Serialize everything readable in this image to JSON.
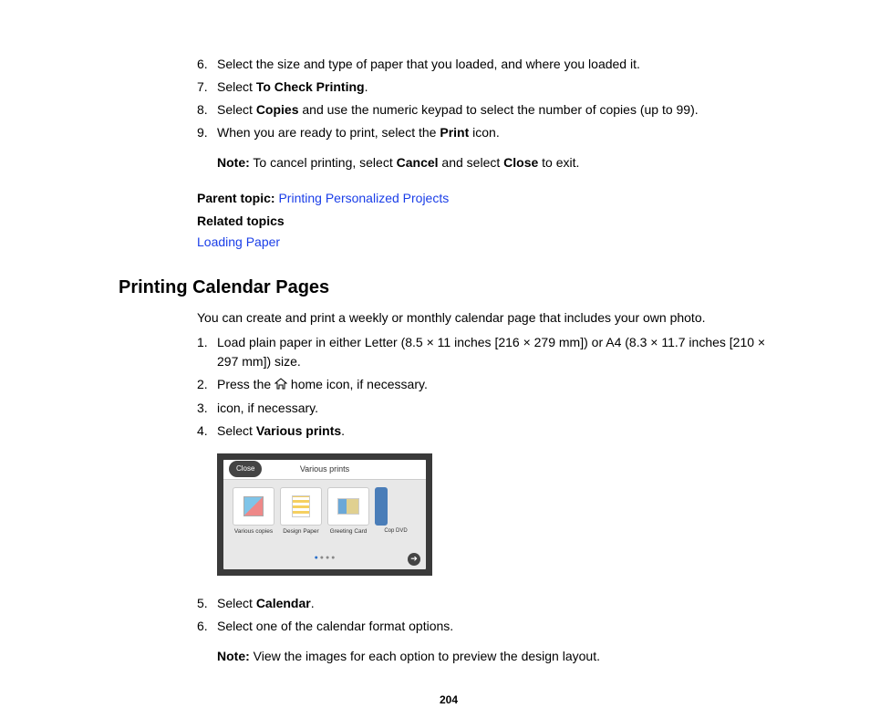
{
  "steps_top": [
    {
      "num": "6.",
      "text": "Select the size and type of paper that you loaded, and where you loaded it."
    },
    {
      "num": "7.",
      "prefix": "Select ",
      "bold": "To Check Printing",
      "suffix": "."
    },
    {
      "num": "8.",
      "prefix": "Select ",
      "bold": "Copies",
      "suffix": " and use the numeric keypad to select the number of copies (up to 99)."
    },
    {
      "num": "9.",
      "prefix": "When you are ready to print, select the ",
      "bold": "Print",
      "suffix": " icon."
    }
  ],
  "note1": {
    "label": "Note:",
    "prefix": " To cancel printing, select ",
    "bold1": "Cancel",
    "mid": " and select ",
    "bold2": "Close",
    "suffix": " to exit."
  },
  "parent_topic": {
    "label": "Parent topic:",
    "link": "Printing Personalized Projects"
  },
  "related_heading": "Related topics",
  "related_link": "Loading Paper",
  "section_heading": "Printing Calendar Pages",
  "intro": "You can create and print a weekly or monthly calendar page that includes your own photo.",
  "steps_cal": [
    {
      "num": "1.",
      "text": "Load plain paper in either Letter (8.5 × 11 inches [216 × 279 mm]) or A4 (8.3 × 11.7 inches [210 × 297 mm]) size."
    },
    {
      "num": "2.",
      "prefix": "Press the ",
      "icon": true,
      "suffix": " home icon, if necessary."
    },
    {
      "num": "3.",
      "text": "icon, if necessary."
    },
    {
      "num": "4.",
      "prefix": "Select ",
      "bold": "Various prints",
      "suffix": "."
    }
  ],
  "illustration": {
    "close": "Close",
    "title": "Various prints",
    "tiles": [
      {
        "label": "Various copies"
      },
      {
        "label": "Design Paper"
      },
      {
        "label": "Greeting Card"
      }
    ],
    "partial_label": "Cop\nDVD"
  },
  "steps_after": [
    {
      "num": "5.",
      "prefix": "Select ",
      "bold": "Calendar",
      "suffix": "."
    },
    {
      "num": "6.",
      "text": "Select one of the calendar format options."
    }
  ],
  "note2": {
    "label": "Note:",
    "text": " View the images for each option to preview the design layout."
  },
  "page_number": "204"
}
